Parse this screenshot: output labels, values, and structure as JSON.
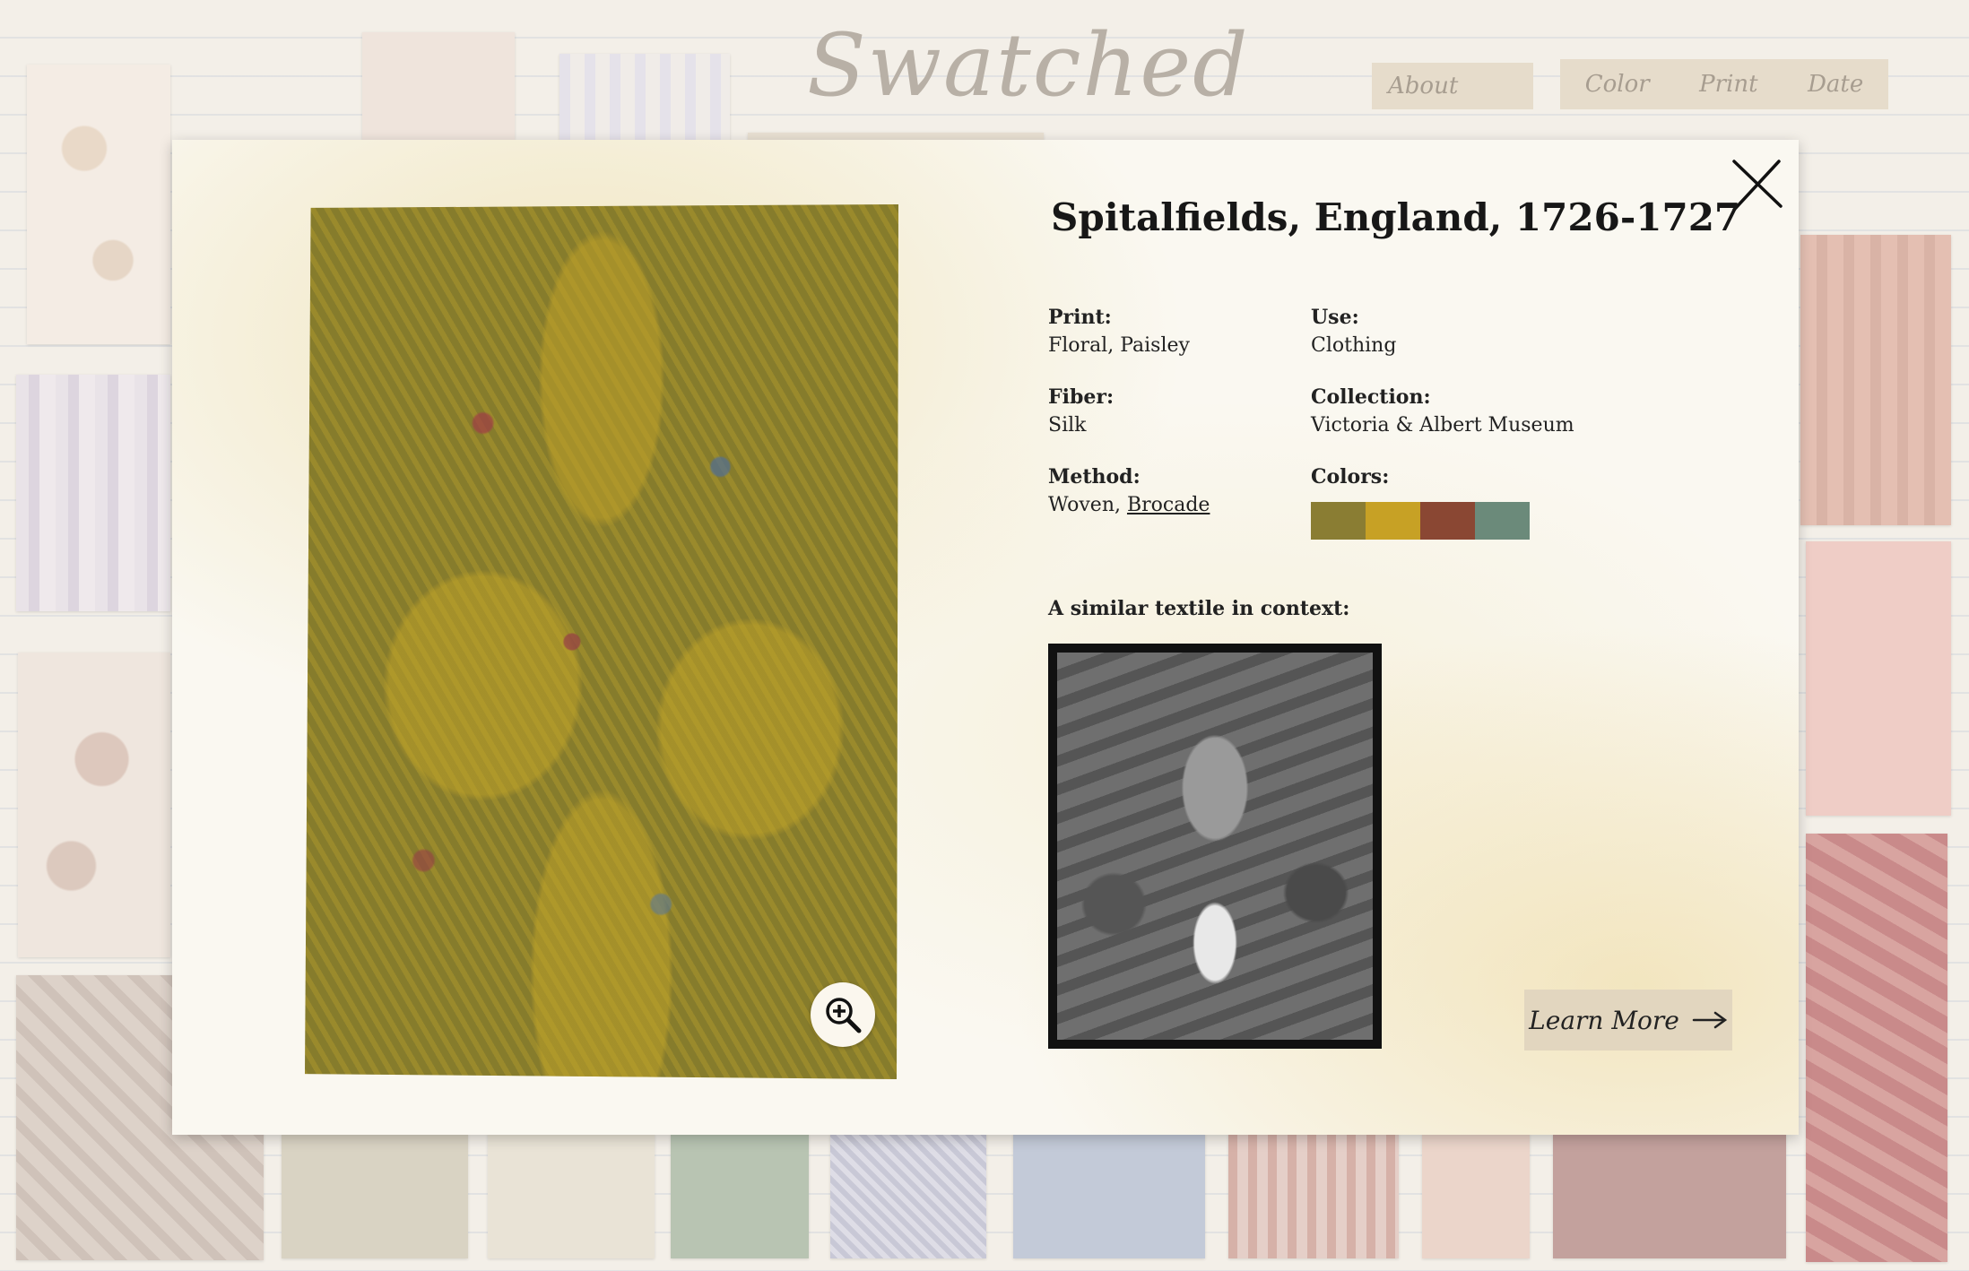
{
  "header": {
    "logo": "Swatched",
    "nav": {
      "about": "About",
      "color": "Color",
      "print": "Print",
      "date": "Date"
    }
  },
  "modal": {
    "title": "Spitalfields, England, 1726-1727",
    "fields": {
      "print": {
        "label": "Print:",
        "value": "Floral, Paisley"
      },
      "use": {
        "label": "Use:",
        "value": "Clothing"
      },
      "fiber": {
        "label": "Fiber:",
        "value": "Silk"
      },
      "collection": {
        "label": "Collection:",
        "value": "Victoria & Albert Museum"
      },
      "method": {
        "label": "Method:",
        "value_prefix": "Woven, ",
        "value_link": "Brocade"
      },
      "colors": {
        "label": "Colors:",
        "swatches": [
          "#8a7d33",
          "#c7a125",
          "#8a4733",
          "#6b8a7a"
        ]
      }
    },
    "context_label": "A similar textile in context:",
    "learn_more": "Learn More",
    "icons": {
      "close": "close-icon",
      "zoom": "zoom-in-icon",
      "arrow": "arrow-right-icon"
    }
  }
}
